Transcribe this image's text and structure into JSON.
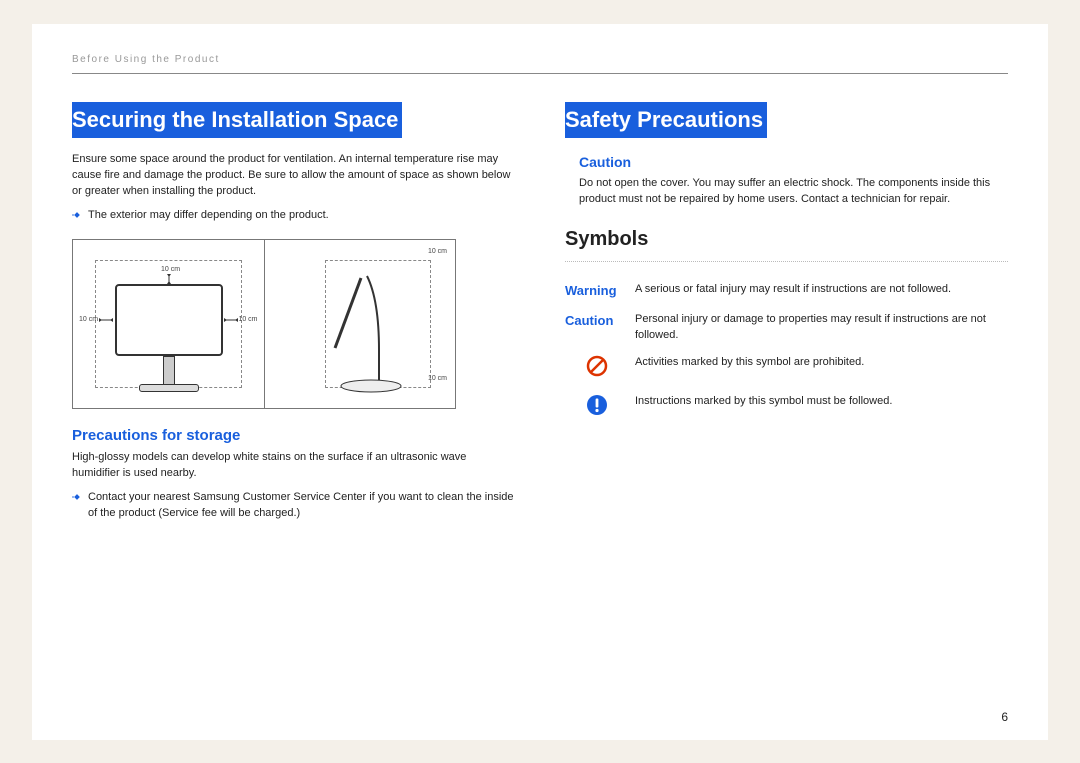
{
  "header": "Before Using the Product",
  "page_number": "6",
  "left": {
    "heading": "Securing the Installation Space",
    "para": "Ensure some space around the product for ventilation. An internal temperature rise may cause fire and damage the product. Be sure to allow the amount of space as shown below or greater when installing the product.",
    "bullet1": "The exterior may differ depending on the product.",
    "dim_top": "10 cm",
    "dim_left": "10 cm",
    "dim_right": "10 cm",
    "dim_side_top": "10 cm",
    "dim_side_bottom": "10 cm",
    "sub_heading": "Precautions for storage",
    "sub_para": "High-glossy models can develop white stains on the surface if an ultrasonic wave humidifier is used nearby.",
    "bullet2": "Contact your nearest Samsung Customer Service Center if you want to clean the inside of the product (Service fee will be charged.)"
  },
  "right": {
    "heading": "Safety Precautions",
    "caution_label": "Caution",
    "caution_text": "Do not open the cover. You may suffer an electric shock. The components inside this product must not be repaired by home users. Contact a technician for repair.",
    "symbols_heading": "Symbols",
    "rows": {
      "warning_label": "Warning",
      "warning_text": "A serious or fatal injury may result if instructions are not followed.",
      "caution_row_label": "Caution",
      "caution_row_text": "Personal injury or damage to properties may result if instructions are not followed.",
      "prohibit_text": "Activities marked by this symbol are prohibited.",
      "mandatory_text": "Instructions marked by this symbol must be followed."
    }
  }
}
